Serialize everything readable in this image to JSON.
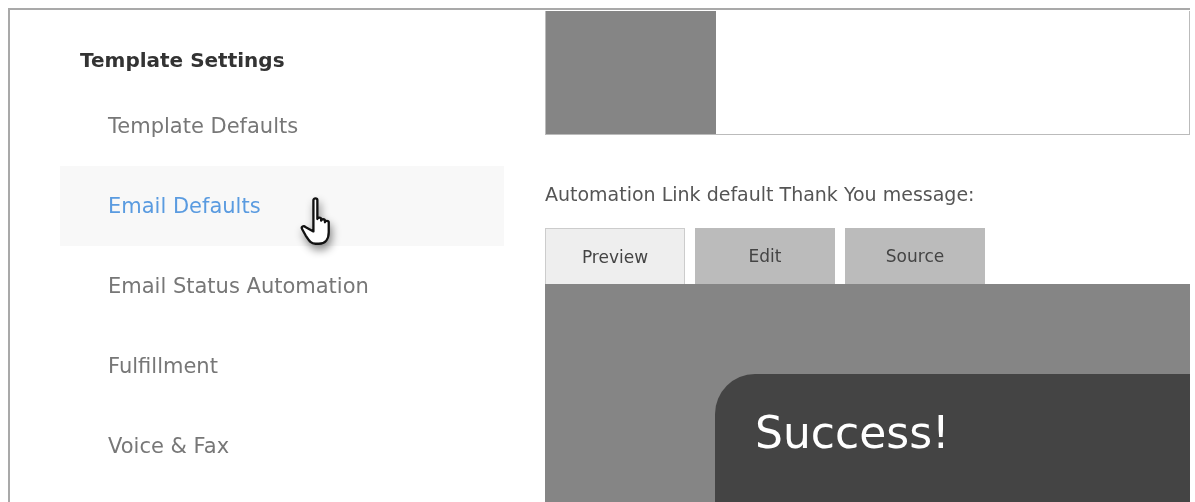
{
  "sidebar": {
    "heading": "Template Settings",
    "items": [
      {
        "label": "Template Defaults",
        "selected": false
      },
      {
        "label": "Email Defaults",
        "selected": true
      },
      {
        "label": "Email Status Automation",
        "selected": false
      },
      {
        "label": "Fulfillment",
        "selected": false
      },
      {
        "label": "Voice & Fax",
        "selected": false
      }
    ]
  },
  "content": {
    "label": "Automation Link default Thank You message:",
    "tabs": [
      {
        "label": "Preview",
        "selected": true
      },
      {
        "label": "Edit",
        "selected": false
      },
      {
        "label": "Source",
        "selected": false
      }
    ],
    "preview": {
      "title": "Success!"
    }
  }
}
